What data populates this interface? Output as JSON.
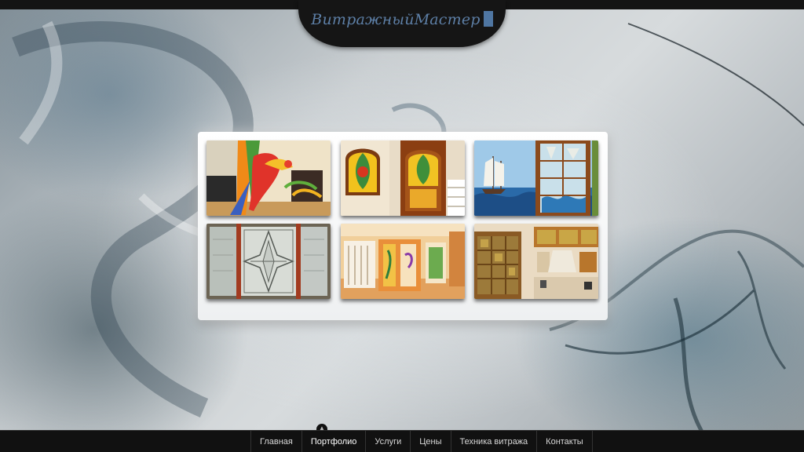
{
  "header": {
    "logo_text": "ВитражныйМастер"
  },
  "gallery": {
    "items": [
      {
        "subject": "parrot-stained-glass-wall"
      },
      {
        "subject": "stained-glass-doors"
      },
      {
        "subject": "sailing-ship-mural-door"
      },
      {
        "subject": "beveled-glass-panel"
      },
      {
        "subject": "interior-stained-glass-partition"
      },
      {
        "subject": "stained-glass-kitchen-cabinets"
      }
    ]
  },
  "nav": {
    "items": [
      {
        "label": "Главная"
      },
      {
        "label": "Портфолио"
      },
      {
        "label": "Услуги"
      },
      {
        "label": "Цены"
      },
      {
        "label": "Техника витража"
      },
      {
        "label": "Контакты"
      }
    ],
    "active_index": 1
  },
  "colors": {
    "bars": "#111111",
    "logo": "#5d7fa6",
    "panel": "#f4f5f6"
  }
}
